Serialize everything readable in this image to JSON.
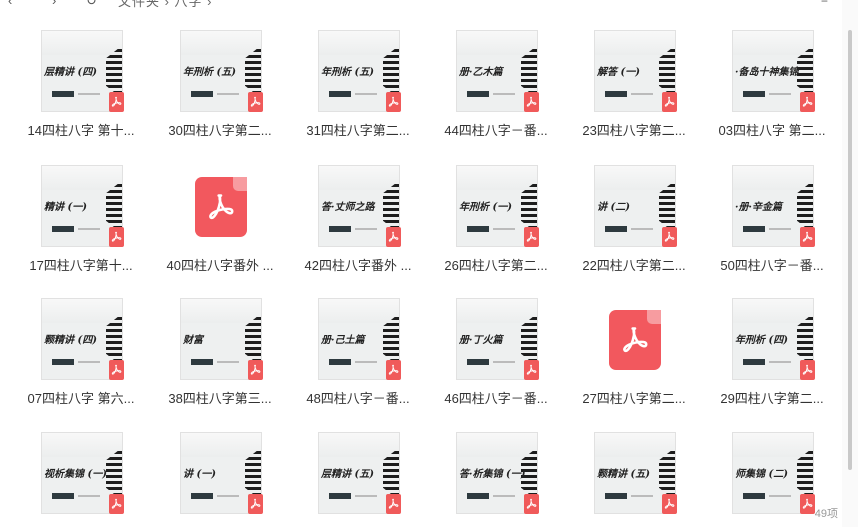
{
  "toolbar": {
    "back": "‹",
    "forward": "›",
    "refresh": "↻",
    "breadcrumb": "文件夹 › 八字 ›",
    "sort": "≡"
  },
  "files": [
    {
      "label": "14四柱八字 第十...",
      "thumb_title": "层精讲 (四)",
      "type": "thumb"
    },
    {
      "label": "30四柱八字第二...",
      "thumb_title": "年刑析 (五)",
      "type": "thumb"
    },
    {
      "label": "31四柱八字第二...",
      "thumb_title": "年刑析 (五)",
      "type": "thumb"
    },
    {
      "label": "44四柱八字－番...",
      "thumb_title": "册·乙木篇",
      "type": "thumb"
    },
    {
      "label": "23四柱八字第二...",
      "thumb_title": "解答 (一)",
      "type": "thumb"
    },
    {
      "label": "03四柱八字 第二...",
      "thumb_title": "·备岛十神集锦",
      "type": "thumb"
    },
    {
      "label": "17四柱八字第十...",
      "thumb_title": "精讲 (一)",
      "type": "thumb"
    },
    {
      "label": "40四柱八字番外 ...",
      "thumb_title": "",
      "type": "pdf"
    },
    {
      "label": "42四柱八字番外 ...",
      "thumb_title": "答·丈师之路",
      "type": "thumb"
    },
    {
      "label": "26四柱八字第二...",
      "thumb_title": "年刑析 (一)",
      "type": "thumb"
    },
    {
      "label": "22四柱八字第二...",
      "thumb_title": "讲 (二)",
      "type": "thumb"
    },
    {
      "label": "50四柱八字－番...",
      "thumb_title": "·册·辛金篇",
      "type": "thumb"
    },
    {
      "label": "07四柱八字 第六...",
      "thumb_title": "颗精讲 (四)",
      "type": "thumb"
    },
    {
      "label": "38四柱八字第三...",
      "thumb_title": "财富",
      "type": "thumb"
    },
    {
      "label": "48四柱八字－番...",
      "thumb_title": "册·己土篇",
      "type": "thumb"
    },
    {
      "label": "46四柱八字－番...",
      "thumb_title": "册·丁火篇",
      "type": "thumb"
    },
    {
      "label": "27四柱八字第二...",
      "thumb_title": "",
      "type": "pdf"
    },
    {
      "label": "29四柱八字第二...",
      "thumb_title": "年刑析 (四)",
      "type": "thumb"
    },
    {
      "label": "",
      "thumb_title": "视析集锦 (一)",
      "type": "thumb"
    },
    {
      "label": "",
      "thumb_title": "讲 (一)",
      "type": "thumb"
    },
    {
      "label": "",
      "thumb_title": "层精讲 (五)",
      "type": "thumb"
    },
    {
      "label": "",
      "thumb_title": "答·析集锦 (一)",
      "type": "thumb"
    },
    {
      "label": "",
      "thumb_title": "颗精讲 (五)",
      "type": "thumb"
    },
    {
      "label": "",
      "thumb_title": "师集锦 (二)",
      "type": "thumb"
    }
  ],
  "status": {
    "count": "49项"
  },
  "colors": {
    "pdf_red": "#f2585e",
    "badge_red": "#f05a5a"
  },
  "icons": {
    "pdf": "acrobat-pdf-icon",
    "thumbnail_art": "bagua-trigram-pattern"
  }
}
